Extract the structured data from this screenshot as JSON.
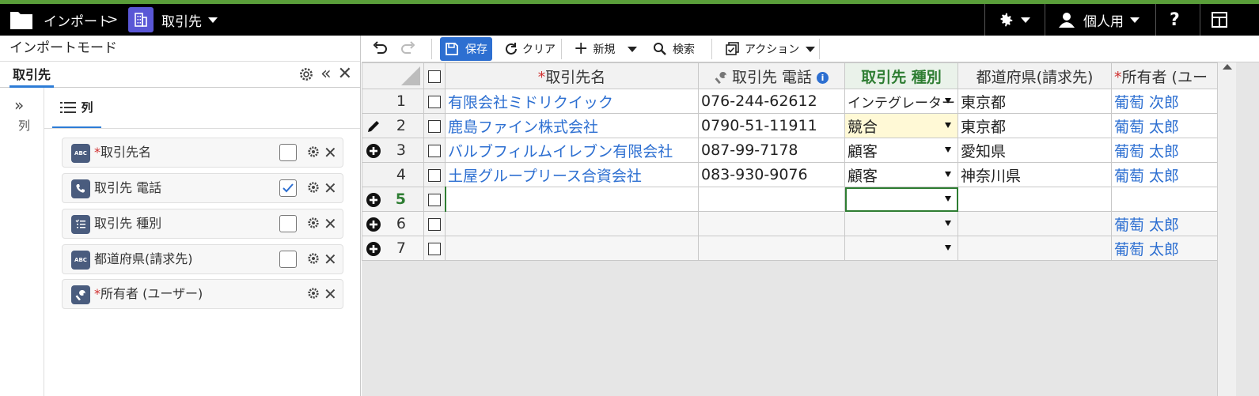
{
  "topbar": {
    "breadcrumb_root": "インポート",
    "breadcrumb_sep": ">",
    "object_name": "取引先",
    "user_label": "個人用",
    "help": "?"
  },
  "left_panel": {
    "title": "インポートモード",
    "tab_label": "取引先",
    "rail_label": "列",
    "subtab_label": "列",
    "fields": [
      {
        "icon": "ABC",
        "icon_name": "text-field-icon",
        "required": true,
        "label": "取引先名",
        "checked": false
      },
      {
        "icon": "phone",
        "icon_name": "phone-icon",
        "required": false,
        "label": "取引先 電話",
        "checked": true
      },
      {
        "icon": "list",
        "icon_name": "picklist-icon",
        "required": false,
        "label": "取引先 種別",
        "checked": false
      },
      {
        "icon": "ABC",
        "icon_name": "text-field-icon",
        "required": false,
        "label": "都道府県(請求先)",
        "checked": false
      },
      {
        "icon": "wrench",
        "icon_name": "lookup-icon",
        "required": true,
        "label": "所有者 (ユーザー)",
        "checked": null
      }
    ]
  },
  "toolbar": {
    "save": "保存",
    "clear": "クリア",
    "new": "新規",
    "search": "検索",
    "action": "アクション"
  },
  "grid": {
    "columns": {
      "name": "取引先名",
      "phone": "取引先 電話",
      "type": "取引先 種別",
      "pref": "都道府県(請求先)",
      "owner": "所有者 (ユー"
    },
    "rows": [
      {
        "num": "1",
        "name": "有限会社ミドリクイック",
        "phone": "076-244-62612",
        "type": "インテグレーター",
        "pref": "東京都",
        "owner": "葡萄 次郎",
        "mark": ""
      },
      {
        "num": "2",
        "name": "鹿島ファイン株式会社",
        "phone": "0790-51-11911",
        "type": "競合",
        "pref": "東京都",
        "owner": "葡萄 太郎",
        "mark": "edit"
      },
      {
        "num": "3",
        "name": "バルブフィルムイレブン有限会社",
        "phone": "087-99-7178",
        "type": "顧客",
        "pref": "愛知県",
        "owner": "葡萄 太郎",
        "mark": "add"
      },
      {
        "num": "4",
        "name": "土屋グループリース合資会社",
        "phone": "083-930-9076",
        "type": "顧客",
        "pref": "神奈川県",
        "owner": "葡萄 太郎",
        "mark": ""
      },
      {
        "num": "5",
        "name": "",
        "phone": "",
        "type": "",
        "pref": "",
        "owner": "",
        "mark": "add"
      },
      {
        "num": "6",
        "name": "",
        "phone": "",
        "type": "",
        "pref": "",
        "owner": "葡萄 太郎",
        "mark": "add"
      },
      {
        "num": "7",
        "name": "",
        "phone": "",
        "type": "",
        "pref": "",
        "owner": "葡萄 太郎",
        "mark": "add"
      }
    ]
  }
}
